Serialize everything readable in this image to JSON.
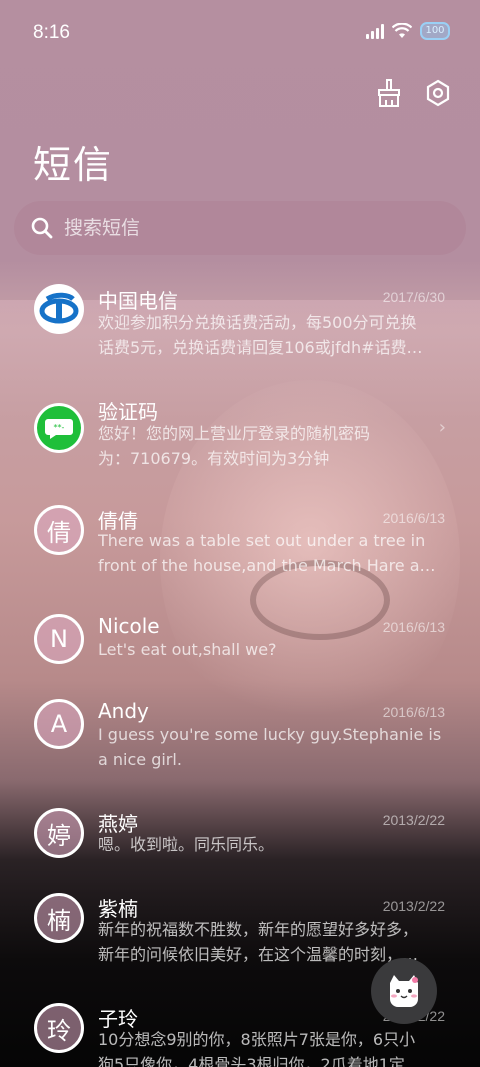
{
  "status": {
    "time": "8:16",
    "battery": "100"
  },
  "title": "短信",
  "search": {
    "placeholder": "搜索短信"
  },
  "messages": [
    {
      "name": "中国电信",
      "date": "2017/6/30",
      "lines": [
        "欢迎参加积分兑换话费活动，每500分可兑换",
        "话费5元，兑换话费请回复106或jfdh#话费…"
      ],
      "avatar": "telecom-logo-icon"
    },
    {
      "name": "验证码",
      "date": "",
      "lines": [
        "您好！您的网上营业厅登录的随机密码",
        "为：710679。有效时间为3分钟"
      ],
      "avatar": "message-bubble-icon",
      "chevron": "›"
    },
    {
      "name": "倩倩",
      "date": "2016/6/13",
      "lines": [
        "There was a table set out under a tree in",
        "front of the house,and the March Hare an…"
      ],
      "initial": "倩"
    },
    {
      "name": "Nicole",
      "date": "2016/6/13",
      "lines": [
        "Let's eat out,shall we?"
      ],
      "initial": "N"
    },
    {
      "name": "Andy",
      "date": "2016/6/13",
      "lines": [
        "I guess you're some lucky guy.Stephanie is",
        "a nice girl."
      ],
      "initial": "A"
    },
    {
      "name": "燕婷",
      "date": "2013/2/22",
      "lines": [
        "嗯。收到啦。同乐同乐。"
      ],
      "initial": "婷"
    },
    {
      "name": "紫楠",
      "date": "2013/2/22",
      "lines": [
        "新年的祝福数不胜数，新年的愿望好多好多，",
        "新年的问候依旧美好，在这个温馨的时刻，…"
      ],
      "initial": "楠"
    },
    {
      "name": "子玲",
      "date": "2013/2/22",
      "lines": [
        "10分想念9别的你，8张照片7张是你，6只小",
        "狗5只像你，4根骨头3根归你，2爪着地1定"
      ],
      "initial": "玲"
    }
  ],
  "colors": {
    "telecom_blue": "#1672c8",
    "wechat_green": "#1fbf3a"
  }
}
